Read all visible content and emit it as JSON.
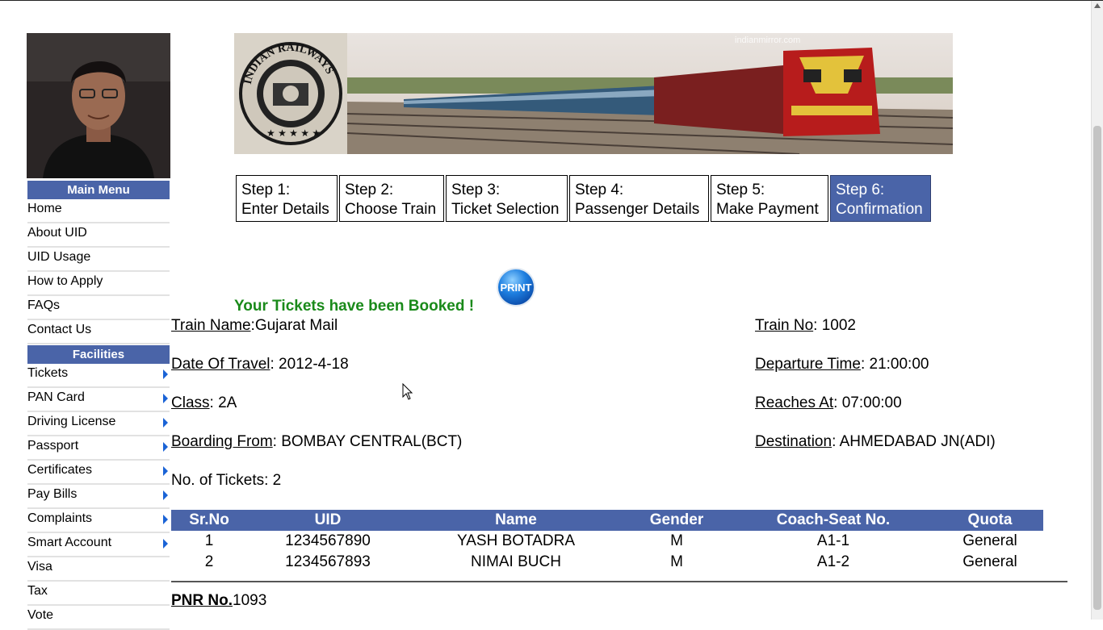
{
  "sidebar": {
    "main_menu_title": "Main Menu",
    "main_items": [
      {
        "label": "Home"
      },
      {
        "label": "About UID"
      },
      {
        "label": "UID Usage"
      },
      {
        "label": "How to Apply"
      },
      {
        "label": "FAQs"
      },
      {
        "label": "Contact Us"
      }
    ],
    "facilities_title": "Facilities",
    "facility_items": [
      {
        "label": "Tickets"
      },
      {
        "label": "PAN Card"
      },
      {
        "label": "Driving License"
      },
      {
        "label": "Passport"
      },
      {
        "label": "Certificates"
      },
      {
        "label": "Pay Bills"
      },
      {
        "label": "Complaints"
      },
      {
        "label": "Smart Account"
      },
      {
        "label": "Visa"
      },
      {
        "label": "Tax"
      },
      {
        "label": "Vote"
      }
    ]
  },
  "banner": {
    "logo_text": "INDIAN RAILWAYS",
    "watermark": "indianmirror.com"
  },
  "steps": [
    {
      "line1": "Step 1:",
      "line2": "Enter Details"
    },
    {
      "line1": "Step 2:",
      "line2": "Choose Train"
    },
    {
      "line1": "Step 3:",
      "line2": "Ticket Selection"
    },
    {
      "line1": "Step 4:",
      "line2": "Passenger Details"
    },
    {
      "line1": "Step 5:",
      "line2": "Make Payment"
    },
    {
      "line1": "Step 6:",
      "line2": "Confirmation"
    }
  ],
  "confirmation": {
    "success_message": "Your Tickets have been Booked !",
    "print_label": "PRINT",
    "train_name_label": "Train Name",
    "train_name_value": ":Gujarat Mail",
    "train_no_label": "Train No",
    "train_no_value": ": 1002",
    "date_label": "Date Of Travel",
    "date_value": ": 2012-4-18",
    "departure_label": "Departure Time",
    "departure_value": ": 21:00:00",
    "class_label": "Class",
    "class_value": ": 2A",
    "reaches_label": "Reaches At",
    "reaches_value": ": 07:00:00",
    "boarding_label": "Boarding From",
    "boarding_value": ": BOMBAY CENTRAL(BCT)",
    "destination_label": "Destination",
    "destination_value": ": AHMEDABAD JN(ADI)",
    "tickets_count": "No. of Tickets: 2"
  },
  "passengers": {
    "headers": [
      "Sr.No",
      "UID",
      "Name",
      "Gender",
      "Coach-Seat No.",
      "Quota"
    ],
    "rows": [
      [
        "1",
        "1234567890",
        "YASH BOTADRA",
        "M",
        "A1-1",
        "General"
      ],
      [
        "2",
        "1234567893",
        "NIMAI BUCH",
        "M",
        "A1-2",
        "General"
      ]
    ]
  },
  "pnr": {
    "label": "PNR No.",
    "value": "1093"
  },
  "colors": {
    "accent": "#4a64a8",
    "success": "#1a8a1a",
    "arrow": "#1a63d6"
  }
}
